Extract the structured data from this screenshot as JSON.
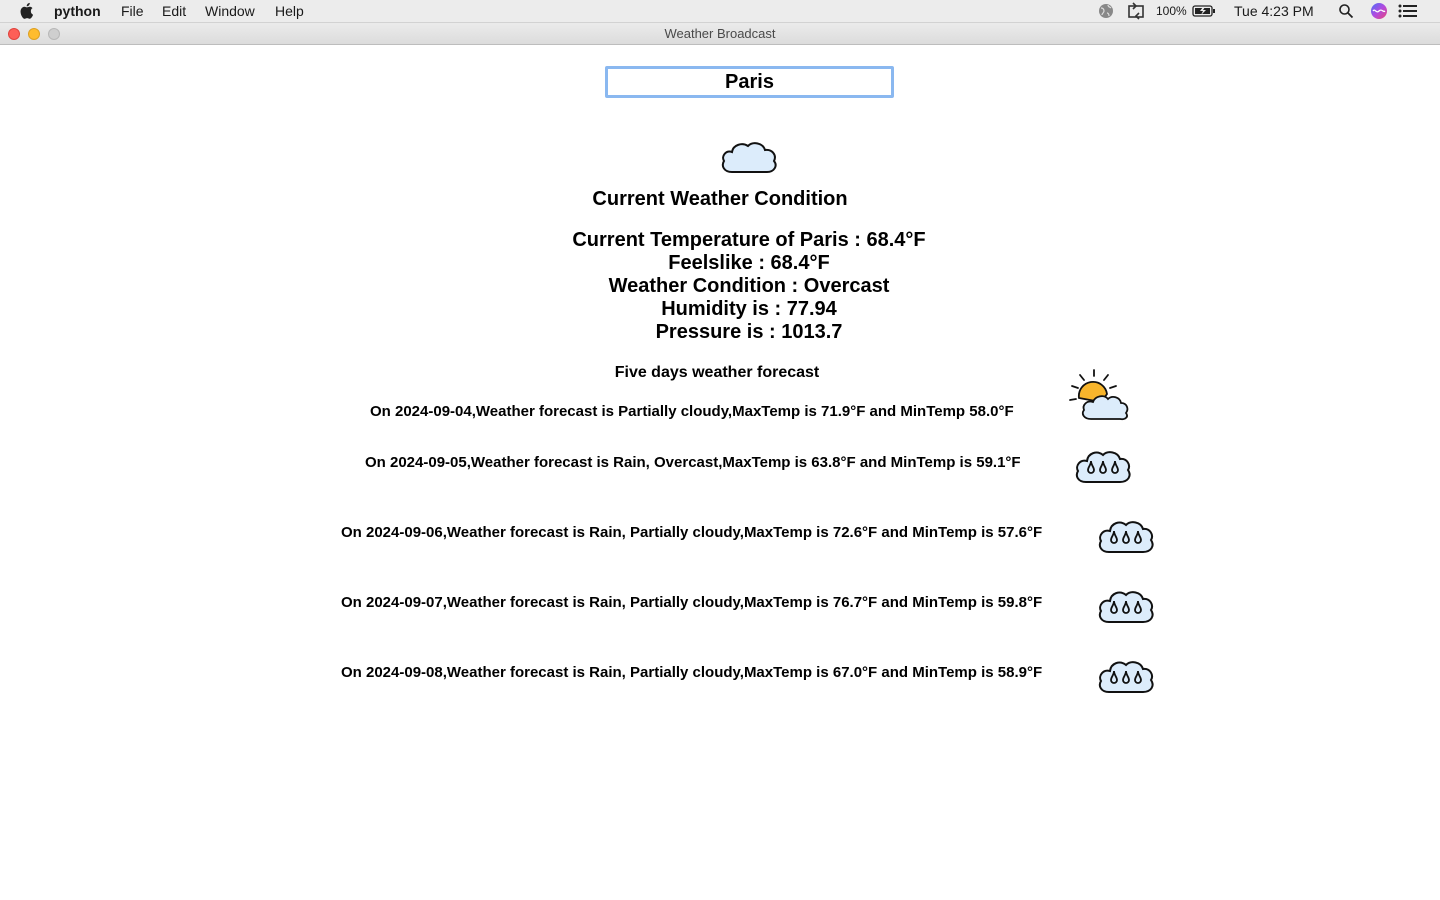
{
  "menubar": {
    "app_name": "python",
    "items": [
      "File",
      "Edit",
      "Window",
      "Help"
    ],
    "battery": "100%",
    "clock": "Tue 4:23 PM"
  },
  "window": {
    "title": "Weather Broadcast"
  },
  "search": {
    "value": "Paris"
  },
  "current": {
    "icon": "cloud-icon",
    "heading": "Current Weather Condition",
    "temperature": "Current Temperature of Paris : 68.4°F",
    "feelslike": "Feelslike : 68.4°F",
    "condition": "Weather Condition : Overcast",
    "humidity": "Humidity is : 77.94",
    "pressure": "Pressure is : 1013.7"
  },
  "forecast": {
    "heading": "Five days weather forecast",
    "days": [
      {
        "text": "On 2024-09-04,Weather forecast is Partially cloudy,MaxTemp is 71.9°F and MinTemp 58.0°F",
        "icon": "sun-behind-cloud-icon"
      },
      {
        "text": "On 2024-09-05,Weather forecast is Rain, Overcast,MaxTemp is 63.8°F and MinTemp is 59.1°F",
        "icon": "rain-cloud-icon"
      },
      {
        "text": "On 2024-09-06,Weather forecast is Rain, Partially cloudy,MaxTemp is 72.6°F and MinTemp is 57.6°F",
        "icon": "rain-cloud-icon"
      },
      {
        "text": "On 2024-09-07,Weather forecast is Rain, Partially cloudy,MaxTemp is 76.7°F and MinTemp is 59.8°F",
        "icon": "rain-cloud-icon"
      },
      {
        "text": "On 2024-09-08,Weather forecast is Rain, Partially cloudy,MaxTemp is 67.0°F and MinTemp is 58.9°F",
        "icon": "rain-cloud-icon"
      }
    ]
  },
  "colors": {
    "cloud_fill": "#dcecfb",
    "sun": "#f7b52c",
    "input_border": "#8ab8f0",
    "close": "#fd5f57",
    "minimize": "#febc2e",
    "zoom": "#cfcfcf"
  }
}
